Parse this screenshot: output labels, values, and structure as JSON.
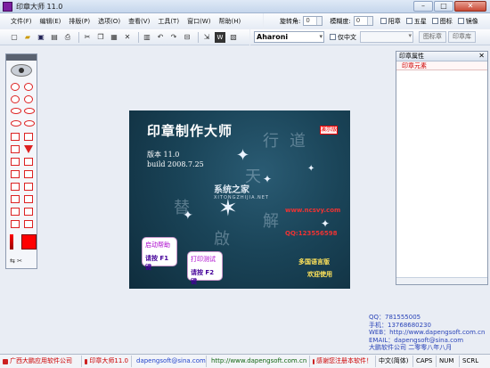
{
  "window": {
    "title": "印章大师 11.0",
    "min": "–",
    "max": "□",
    "close": "✕"
  },
  "menu": [
    "文件(F)",
    "编辑(E)",
    "排版(P)",
    "选项(O)",
    "查看(V)",
    "工具(T)",
    "窗口(W)",
    "帮助(H)"
  ],
  "options": {
    "rotation_label": "旋转角:",
    "rotation_value": "0",
    "blur_label": "模糊度:",
    "blur_value": "0",
    "checks": [
      "阳章",
      "五星",
      "图标",
      "镜像"
    ],
    "font_name": "Aharoni",
    "only_cn_label": "仅中文",
    "btn_graphics": "图标章",
    "btn_seal": "印章库"
  },
  "splash": {
    "title": "印章制作大师",
    "badge": "演示版",
    "version": "版本 11.0",
    "build": "build 2008.7.25",
    "logo": "系统之家",
    "logo_sub": "XITONGZHIJIA.NET",
    "url": "www.ncsvy.com",
    "qq": "QQ:123556598",
    "calligraphy": [
      "行",
      "道",
      "替",
      "天",
      "解",
      "啟"
    ],
    "btn_help_line1": "启动帮助",
    "btn_help_line2": "请按 F1 键",
    "btn_print_line1": "打印测试",
    "btn_print_line2": "请按 F2 键",
    "promo_line1": "多国语言版",
    "promo_line2": "欢迎使用"
  },
  "right_panel": {
    "title": "印章属性",
    "close": "✕",
    "tab": "印章元素"
  },
  "contact": [
    "QQ：781555005",
    "手机：13768680230",
    "WEB：http://www.dapengsoft.com.cn",
    "EMAIL：dapengsoft@sina.com",
    "大鹏软件公司 二零零八年八月"
  ],
  "status": [
    "广西大鹏应用软件公司",
    "印章大师11.0",
    "dapengsoft@sina.com",
    "http://www.dapengsoft.com.cn",
    "感谢您注册本软件！",
    "中文(简体)",
    "CAPS",
    "NUM",
    "SCRL"
  ],
  "palette_footer": "⇆ ✂"
}
